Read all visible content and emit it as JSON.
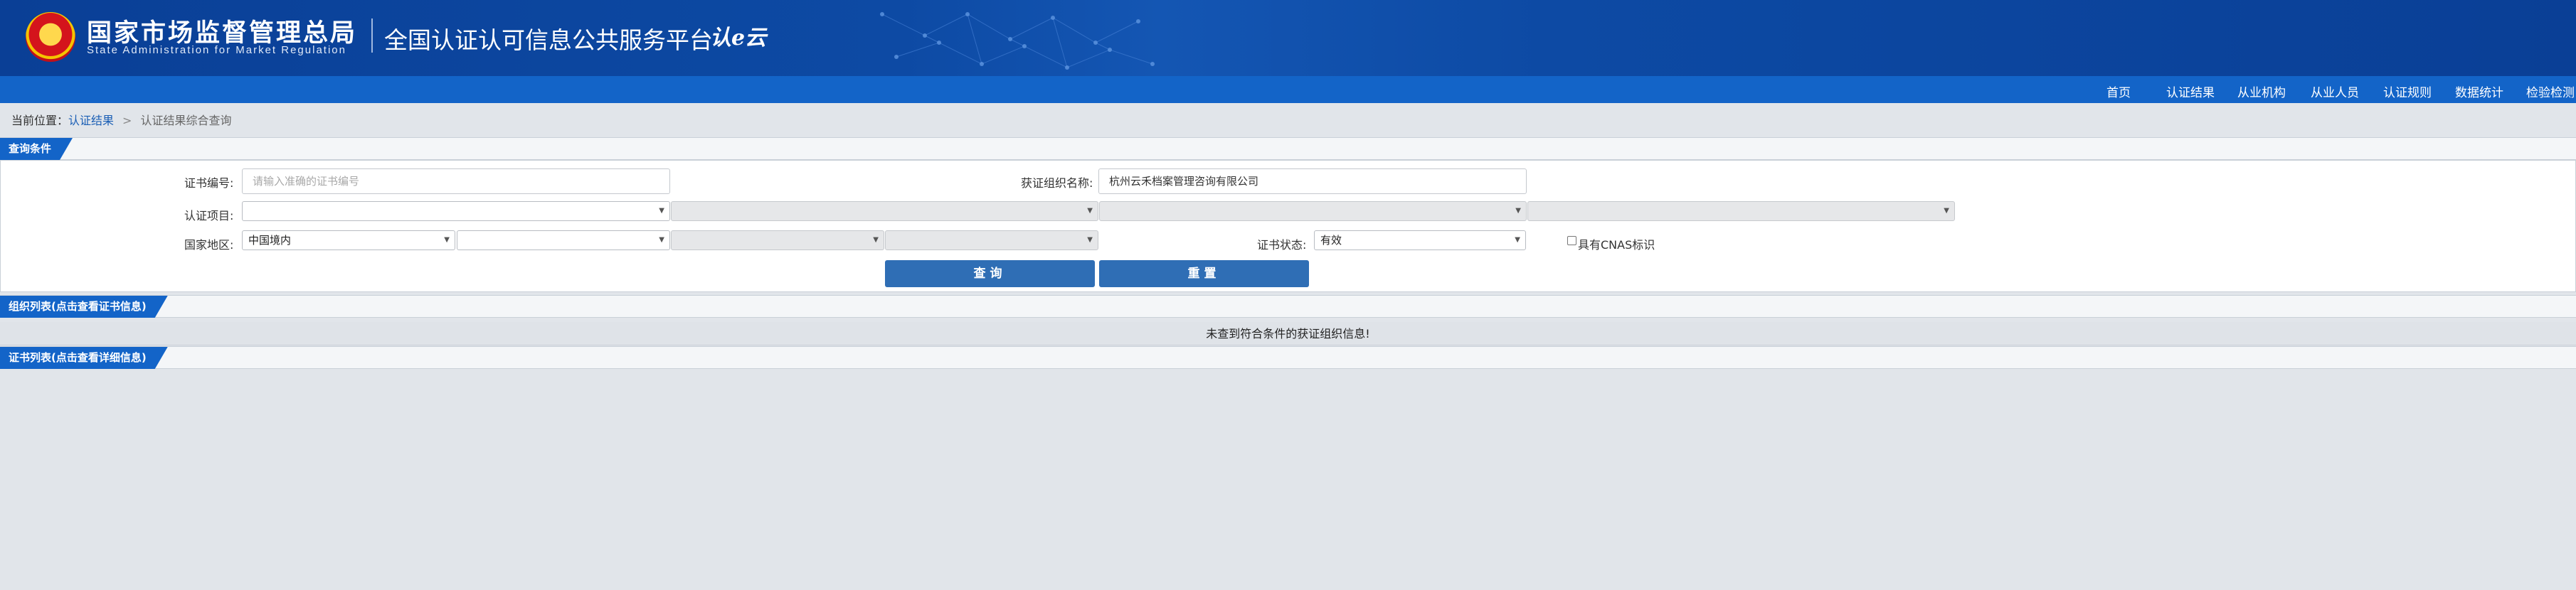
{
  "header": {
    "agency_cn": "国家市场监督管理总局",
    "agency_en": "State Administration  for  Market Regulation",
    "platform_name": "全国认证认可信息公共服务平台",
    "logo_text": "认e云",
    "emblem_icon": "national-emblem-icon"
  },
  "nav": {
    "items": [
      "首页",
      "认证结果",
      "从业机构",
      "从业人员",
      "认证规则",
      "数据统计",
      "检验检测"
    ]
  },
  "breadcrumb": {
    "prefix": "当前位置：",
    "link": "认证结果",
    "separator": ">",
    "current": "认证结果综合查询"
  },
  "query": {
    "section_title": "查询条件",
    "cert_no_label": "证书编号:",
    "cert_no_placeholder": "请输入准确的证书编号",
    "org_name_label": "获证组织名称:",
    "org_name_value": "杭州云禾档案管理咨询有限公司",
    "project_label": "认证项目:",
    "region_label": "国家地区:",
    "region_value": "中国境内",
    "status_label": "证书状态:",
    "status_value": "有效",
    "cnas_label": "具有CNAS标识",
    "search_button": "查询",
    "reset_button": "重置"
  },
  "org_list": {
    "section_title": "组织列表(点击查看证书信息)",
    "empty_message": "未查到符合条件的获证组织信息!"
  },
  "cert_list": {
    "section_title": "证书列表(点击查看详细信息)"
  },
  "colors": {
    "banner": "#0d4aa4",
    "nav": "#1364c8",
    "button": "#2f6eb5",
    "background": "#e1e5ea"
  }
}
